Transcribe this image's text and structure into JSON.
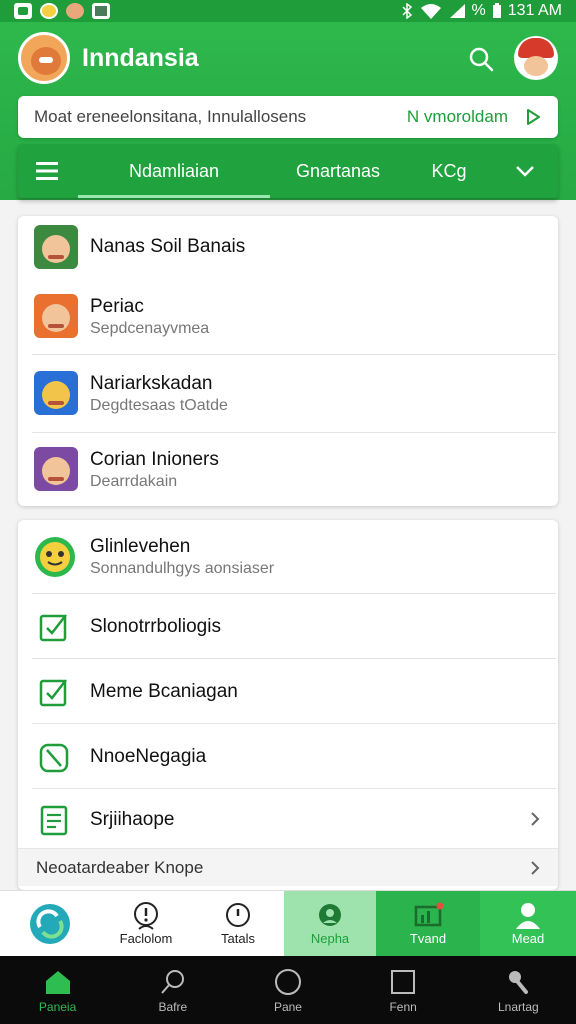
{
  "status_bar": {
    "time": "131 AM",
    "battery": "%"
  },
  "header": {
    "app_title": "Inndansia",
    "search": {
      "text": "Moat ereneelonsitana, Innulallosens",
      "action_label": "N vmoroldam"
    },
    "tabs": [
      "Ndamliaian",
      "Gnartanas",
      "KCg"
    ]
  },
  "colors": {
    "primary": "#2db84c",
    "primary_dark": "#1e9d3a",
    "accent_light": "#9ee3ad"
  },
  "featured": [
    {
      "title": "Nanas Soil Banais",
      "subtitle": "",
      "thumb": "green"
    },
    {
      "title": "Periac",
      "subtitle": "Sepdcenayvmea",
      "thumb": "orange"
    },
    {
      "title": "Nariarkskadan",
      "subtitle": "Degdtesaas tOatde",
      "thumb": "blue"
    },
    {
      "title": "Corian Inioners",
      "subtitle": "Dearrdakain",
      "thumb": "purple"
    }
  ],
  "settings": [
    {
      "title": "Glinlevehen",
      "subtitle": "Sonnandulhgys aonsiaser",
      "icon": "smiley-icon"
    },
    {
      "title": "Slonotrrboliogis",
      "icon": "checkbox-checked-icon"
    },
    {
      "title": "Meme Bcaniagan",
      "icon": "checkbox-checked-icon"
    },
    {
      "title": "NnoeNegagia",
      "icon": "checkbox-slash-icon"
    },
    {
      "title": "Srjiihaope",
      "icon": "document-list-icon"
    }
  ],
  "footer_row": {
    "label": "Neoatardeaber Knope"
  },
  "bottom_tabs": [
    {
      "label": "",
      "icon": "refresh-logo-icon"
    },
    {
      "label": "Faclolom",
      "icon": "alert-person-icon"
    },
    {
      "label": "Tatals",
      "icon": "clock-icon"
    },
    {
      "label": "Nepha",
      "icon": "headset-icon"
    },
    {
      "label": "Tvand",
      "icon": "chart-icon"
    },
    {
      "label": "Mead",
      "icon": "person-icon"
    }
  ],
  "system_nav": [
    {
      "label": "Paneia",
      "icon": "home-icon"
    },
    {
      "label": "Bafre",
      "icon": "search-icon"
    },
    {
      "label": "Pane",
      "icon": "circle-icon"
    },
    {
      "label": "Fenn",
      "icon": "square-icon"
    },
    {
      "label": "Lnartag",
      "icon": "tool-icon"
    }
  ]
}
